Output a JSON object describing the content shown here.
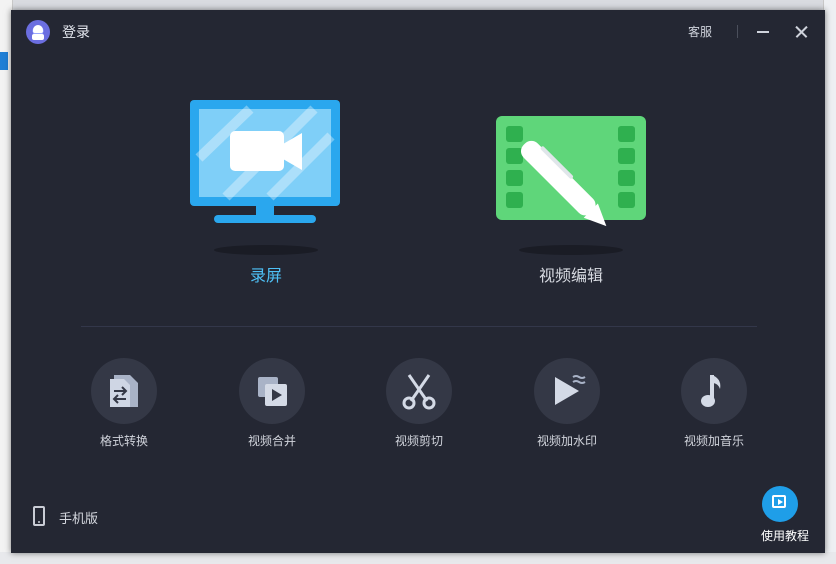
{
  "titlebar": {
    "login_label": "登录",
    "service_label": "客服"
  },
  "features": {
    "record_label": "录屏",
    "edit_label": "视频编辑"
  },
  "tools": [
    {
      "label": "格式转换",
      "icon": "format-convert-icon"
    },
    {
      "label": "视频合并",
      "icon": "video-merge-icon"
    },
    {
      "label": "视频剪切",
      "icon": "scissors-icon"
    },
    {
      "label": "视频加水印",
      "icon": "watermark-icon"
    },
    {
      "label": "视频加音乐",
      "icon": "music-note-icon"
    }
  ],
  "footer": {
    "mobile_label": "手机版",
    "tutorial_label": "使用教程"
  },
  "colors": {
    "window_bg": "#242733",
    "accent_blue": "#4ec0f6",
    "edit_green": "#5fd67a",
    "tool_circle": "#343846"
  }
}
